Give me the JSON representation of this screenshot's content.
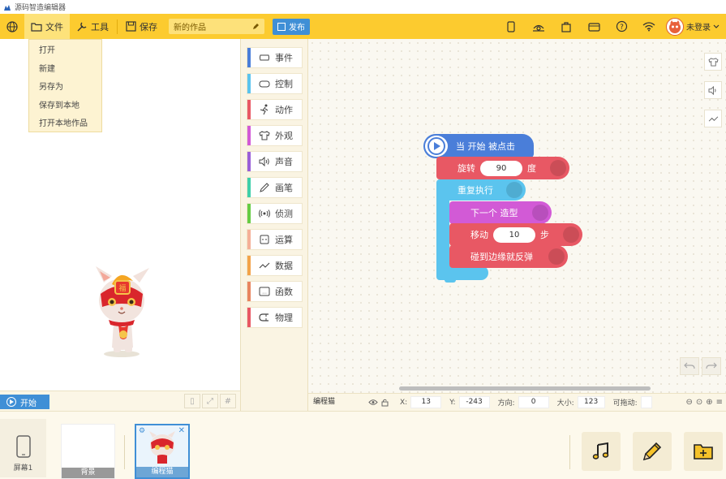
{
  "app": {
    "title": "源码智造编辑器"
  },
  "menubar": {
    "file_label": "文件",
    "tools_label": "工具",
    "save_label": "保存",
    "project_title": "新的作品",
    "publish_label": "发布",
    "login_label": "未登录"
  },
  "file_menu": {
    "items": [
      {
        "label": "打开"
      },
      {
        "label": "新建"
      },
      {
        "label": "另存为"
      },
      {
        "label": "保存到本地"
      },
      {
        "label": "打开本地作品"
      }
    ]
  },
  "stage": {
    "start_label": "开始"
  },
  "categories": [
    {
      "label": "事件",
      "color": "#4a7ed9",
      "icon": "event-icon"
    },
    {
      "label": "控制",
      "color": "#5bc4ee",
      "icon": "gamepad-icon"
    },
    {
      "label": "动作",
      "color": "#e85864",
      "icon": "runner-icon"
    },
    {
      "label": "外观",
      "color": "#d25ad6",
      "icon": "shirt-icon"
    },
    {
      "label": "声音",
      "color": "#9a60d8",
      "icon": "speaker-icon"
    },
    {
      "label": "画笔",
      "color": "#3fcfaa",
      "icon": "pen-icon"
    },
    {
      "label": "侦测",
      "color": "#66cc44",
      "icon": "sensor-icon"
    },
    {
      "label": "运算",
      "color": "#f5b098",
      "icon": "calculator-icon"
    },
    {
      "label": "数据",
      "color": "#f3a34a",
      "icon": "chart-line-icon"
    },
    {
      "label": "函数",
      "color": "#e8855f",
      "icon": "function-icon"
    },
    {
      "label": "物理",
      "color": "#e85864",
      "icon": "magnet-icon"
    }
  ],
  "blocks": {
    "hat": "当 开始 被点击",
    "rotate": {
      "label": "旋转",
      "value": "90",
      "unit": "度"
    },
    "repeat": "重复执行",
    "costume": "下一个 造型",
    "move": {
      "label": "移动",
      "value": "10",
      "unit": "步"
    },
    "bounce": "碰到边缘就反弹"
  },
  "status": {
    "sprite_name": "编程猫",
    "x_label": "X:",
    "x_value": "13",
    "y_label": "Y:",
    "y_value": "-243",
    "dir_label": "方向:",
    "dir_value": "0",
    "size_label": "大小:",
    "size_value": "123",
    "drag_label": "可拖动:"
  },
  "bottom": {
    "screen_label": "屏幕1",
    "background_label": "背景",
    "sprite_label": "编程猫"
  }
}
